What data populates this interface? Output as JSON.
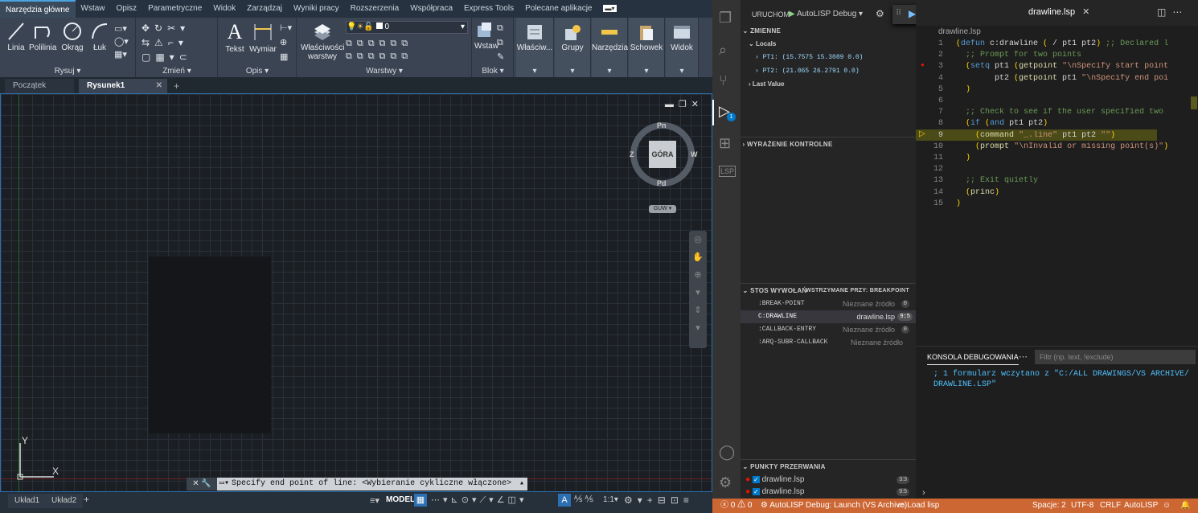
{
  "acad": {
    "ribbon_tabs": [
      "Narzędzia główne",
      "Wstaw",
      "Opisz",
      "Parametryczne",
      "Widok",
      "Zarządzaj",
      "Wyniki pracy",
      "Rozszerzenia",
      "Współpraca",
      "Express Tools",
      "Polecane aplikacje"
    ],
    "draw": {
      "linia": "Linia",
      "polilinia": "Polilinia",
      "okrag": "Okrąg",
      "luk": "Łuk",
      "panel": "Rysuj"
    },
    "modify_panel": "Zmień",
    "annot": {
      "tekst": "Tekst",
      "wymiar": "Wymiar",
      "panel": "Opis"
    },
    "layers": {
      "props": "Właściwości",
      "props2": "warstwy",
      "panel": "Warstwy",
      "layer_value": "0"
    },
    "block": {
      "wstaw": "Wstaw",
      "panel": "Blok"
    },
    "extra_buttons": [
      "Właściw...",
      "Grupy",
      "Narzędzia",
      "Schowek",
      "Widok"
    ],
    "doc_tabs": {
      "start": "Początek",
      "drawing": "Rysunek1"
    },
    "viewcube": {
      "top": "GÓRA",
      "n": "Pn",
      "s": "Pd",
      "w": "W",
      "e": "Z",
      "ucs": "GUW"
    },
    "ucs": {
      "y": "Y",
      "x": "X"
    },
    "command_line": "Specify end point of line:  <Wybieranie cykliczne włączone>",
    "layout_tabs": [
      "Układ1",
      "Układ2"
    ],
    "status_model": "MODEL",
    "status_scale": "1:1"
  },
  "vscode": {
    "run_label": "URUCHOM",
    "config": "AutoLISP Debug",
    "file_tab": "drawline.lsp",
    "breadcrumb": "drawline.lsp",
    "variables_h": "ZMIENNE",
    "locals_h": "Locals",
    "pt1": "PT1: (15.7575 15.3089 0.0)",
    "pt2": "PT2: (21.065 26.2791 0.0)",
    "last_value": "Last Value",
    "watch_h": "WYRAŻENIE KONTROLNE",
    "callstack_h": "STOS WYWOŁAŃ",
    "paused": "WSTRZYMANE PRZY: BREAKPOINT",
    "stack": [
      {
        "name": ":BREAK-POINT",
        "src": "Nieznane źródło",
        "badge": "0"
      },
      {
        "name": "C:DRAWLINE",
        "src": "drawline.lsp",
        "badge": "9:5"
      },
      {
        "name": ":CALLBACK-ENTRY",
        "src": "Nieznane źródło",
        "badge": "0"
      },
      {
        "name": ":ARQ-SUBR-CALLBACK",
        "src": "Nieznane źródło",
        "badge": ""
      }
    ],
    "breakpoints_h": "PUNKTY PRZERWANIA",
    "breakpoints": [
      {
        "file": "drawline.lsp",
        "pos": "3:3"
      },
      {
        "file": "drawline.lsp",
        "pos": "9:5"
      }
    ],
    "console_tab": "KONSOLA DEBUGOWANIA",
    "filter_placeholder": "Filtr (np. text, !exclude)",
    "console_output": "; 1 formularz wczytano z \"C:/ALL DRAWINGS/VS ARCHIVE/DRAWLINE.LSP\"",
    "status": {
      "errors": "0",
      "warnings": "0",
      "debug": "AutoLISP Debug: Launch (VS Archive)",
      "load": "Load lisp",
      "spaces": "Spacje: 2",
      "enc": "UTF-8",
      "eol": "CRLF",
      "lang": "AutoLISP"
    },
    "code_lines": [
      "(defun c:drawline ( / pt1 pt2) ;; Declared l",
      "  ;; Prompt for two points",
      "  (setq pt1 (getpoint \"\\nSpecify start point",
      "        pt2 (getpoint pt1 \"\\nSpecify end poi",
      "  )",
      "",
      "  ;; Check to see if the user specified two",
      "  (if (and pt1 pt2)",
      "    (command \"_.line\" pt1 pt2 \"\")",
      "    (prompt \"\\nInvalid or missing point(s)\")",
      "  )",
      "",
      "  ;; Exit quietly",
      "  (princ)",
      ")"
    ]
  }
}
